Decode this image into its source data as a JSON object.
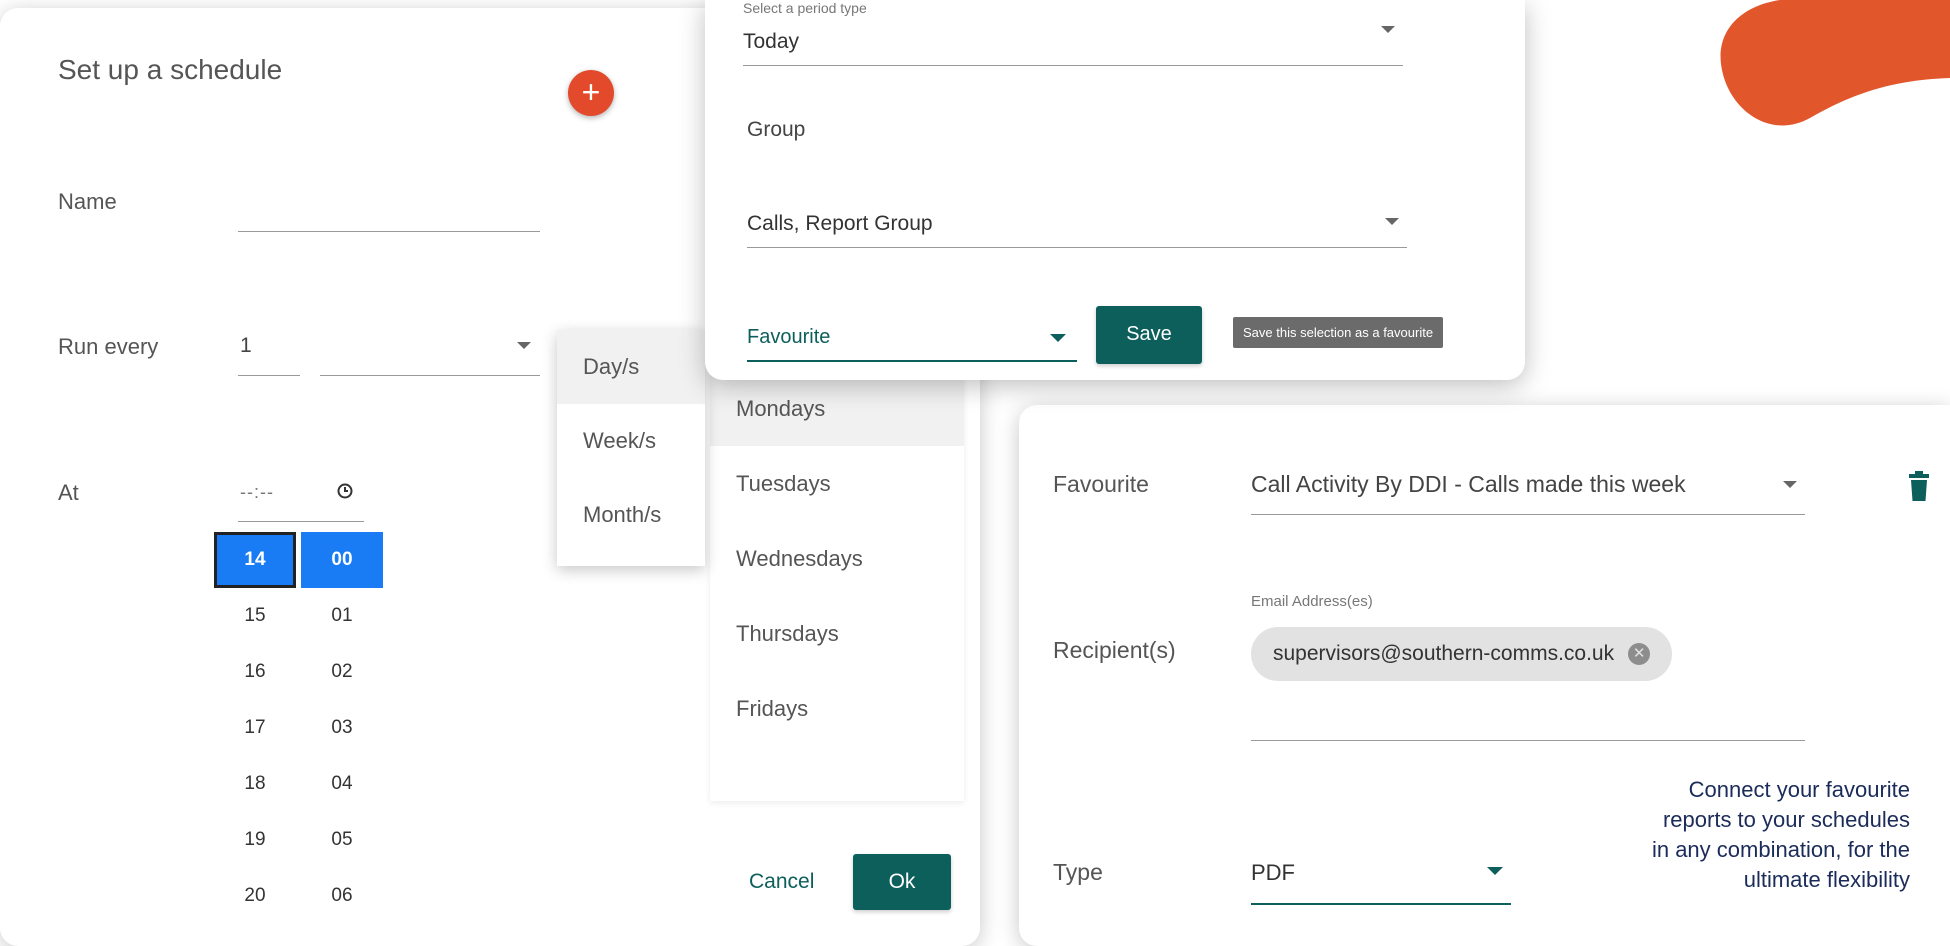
{
  "colors": {
    "accent_orange": "#e2562b",
    "teal": "#0d5f5c",
    "time_selected": "#1a7cf5"
  },
  "schedule": {
    "title": "Set up a schedule",
    "add_icon": "plus-icon",
    "name_label": "Name",
    "run_every_label": "Run every",
    "run_every_value": "1",
    "at_label": "At",
    "time_placeholder": "--:--",
    "clock_icon": "clock-icon",
    "hours": [
      "14",
      "15",
      "16",
      "17",
      "18",
      "19",
      "20"
    ],
    "minutes": [
      "00",
      "01",
      "02",
      "03",
      "04",
      "05",
      "06"
    ],
    "interval_options": [
      "Day/s",
      "Week/s",
      "Month/s"
    ],
    "day_options": [
      "Mondays",
      "Tuesdays",
      "Wednesdays",
      "Thursdays",
      "Fridays"
    ],
    "cancel_label": "Cancel",
    "ok_label": "Ok"
  },
  "period": {
    "period_type_label": "Select a period type",
    "period_type_value": "Today",
    "group_label": "Group",
    "group_value": "Calls, Report Group",
    "favourite_value": "Favourite",
    "save_label": "Save",
    "save_tooltip": "Save this selection as a favourite"
  },
  "favourite_panel": {
    "favourite_label": "Favourite",
    "favourite_value": "Call Activity By DDI - Calls made this week",
    "delete_icon": "trash-icon",
    "recipients_label": "Recipient(s)",
    "email_label": "Email Address(es)",
    "email_chip": "supervisors@southern-comms.co.uk",
    "type_label": "Type",
    "type_value": "PDF"
  },
  "caption": {
    "lines": [
      "Connect your favourite",
      "reports to your schedules",
      "in any combination, for the",
      "ultimate flexibility"
    ]
  }
}
